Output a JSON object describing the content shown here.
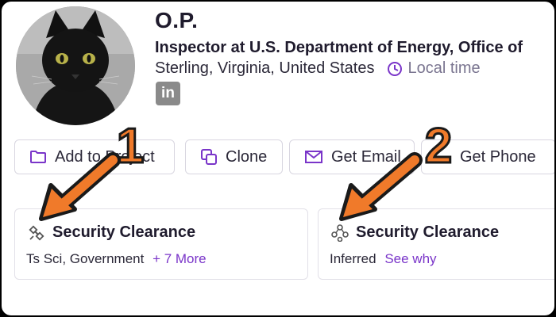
{
  "profile": {
    "name": "O.P.",
    "title": "Inspector at U.S. Department of Energy, Office of",
    "location": "Sterling, Virginia, United States",
    "local_time_label": "Local time",
    "linkedin_label": "in"
  },
  "actions": {
    "add_to_project": "Add to Project",
    "clone": "Clone",
    "get_email": "Get Email",
    "get_phone": "Get Phone"
  },
  "cards": [
    {
      "title": "Security Clearance",
      "detail": "Ts Sci, Government",
      "link": "+ 7 More"
    },
    {
      "title": "Security Clearance",
      "detail": "Inferred",
      "link": "See why"
    }
  ],
  "callouts": [
    "1",
    "2"
  ],
  "colors": {
    "accent": "#7a35c9",
    "arrow": "#f07a2a",
    "text": "#1f1b2d"
  }
}
